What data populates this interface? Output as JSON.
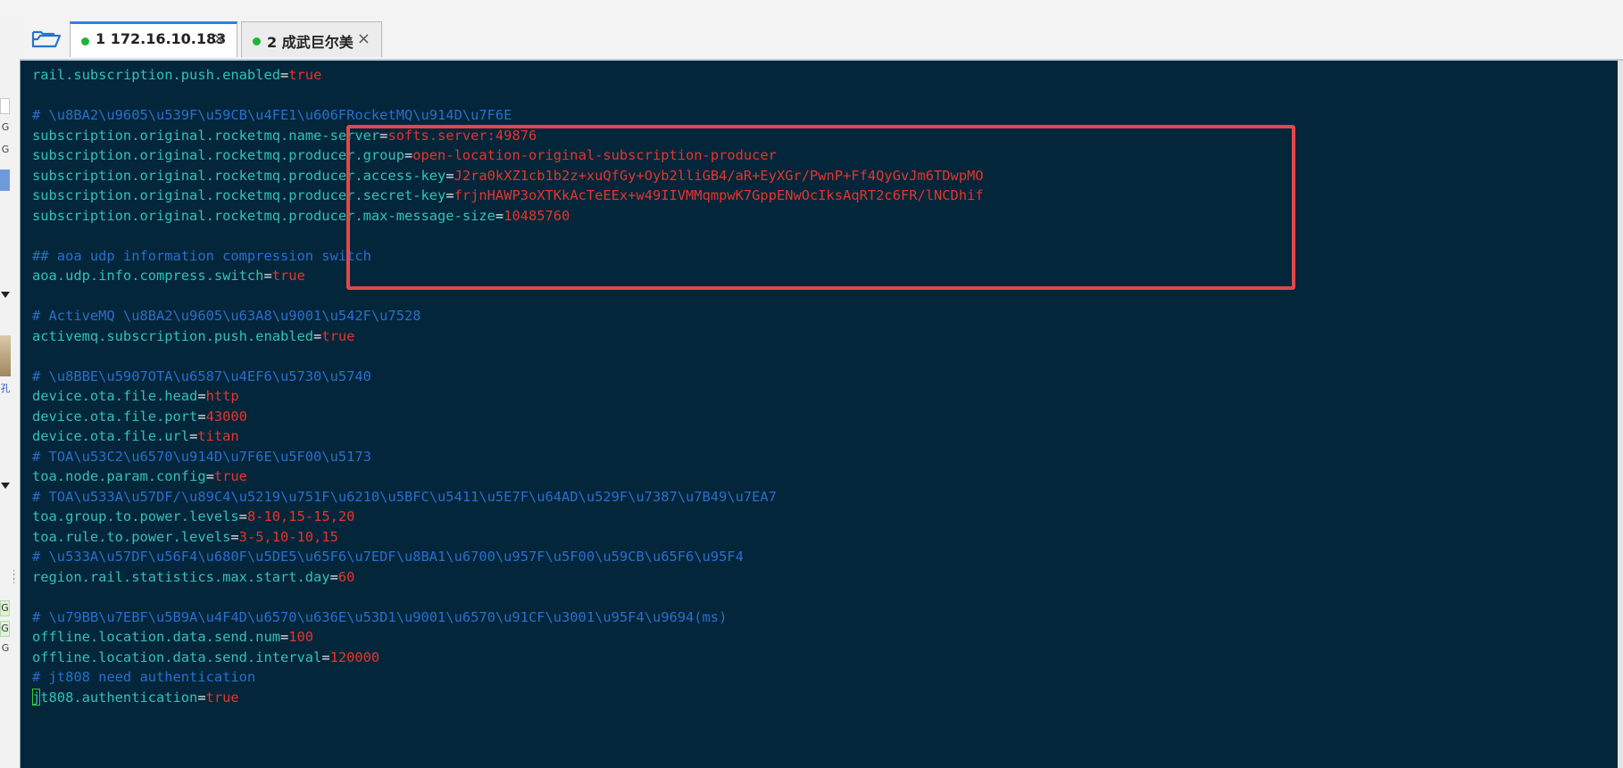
{
  "tabs": [
    {
      "number": "1",
      "title": "172.16.10.183",
      "active": true,
      "status": "connected"
    },
    {
      "number": "2",
      "title": "成武巨尔美",
      "active": false,
      "status": "connected"
    }
  ],
  "close_glyph": "×",
  "left_panel_glyphs": [
    "G",
    "G",
    "G",
    "孔",
    "G",
    "G",
    "G"
  ],
  "terminal_lines": [
    {
      "type": "kv",
      "key": "rail.subscription.push.enabled",
      "value": "true"
    },
    {
      "type": "blank"
    },
    {
      "type": "comment",
      "text": "# \\u8BA2\\u9605\\u539F\\u59CB\\u4FE1\\u606FRocketMQ\\u914D\\u7F6E"
    },
    {
      "type": "kv",
      "key": "subscription.original.rocketmq.name-server",
      "value": "softs.server:49876"
    },
    {
      "type": "kv",
      "key": "subscription.original.rocketmq.producer.group",
      "value": "open-location-original-subscription-producer"
    },
    {
      "type": "kv",
      "key": "subscription.original.rocketmq.producer.access-key",
      "value": "J2ra0kXZ1cb1b2z+xuQfGy+Oyb2lliGB4/aR+EyXGr/PwnP+Ff4QyGvJm6TDwpMO"
    },
    {
      "type": "kv",
      "key": "subscription.original.rocketmq.producer.secret-key",
      "value": "frjnHAWP3oXTKkAcTeEEx+w49IIVMMqmpwK7GppENwOcIksAqRT2c6FR/lNCDhif"
    },
    {
      "type": "kv",
      "key": "subscription.original.rocketmq.producer.max-message-size",
      "value": "10485760"
    },
    {
      "type": "blank"
    },
    {
      "type": "comment",
      "text": "## aoa udp information compression switch"
    },
    {
      "type": "kv",
      "key": "aoa.udp.info.compress.switch",
      "value": "true"
    },
    {
      "type": "blank"
    },
    {
      "type": "comment",
      "text": "# ActiveMQ \\u8BA2\\u9605\\u63A8\\u9001\\u542F\\u7528"
    },
    {
      "type": "kv",
      "key": "activemq.subscription.push.enabled",
      "value": "true"
    },
    {
      "type": "blank"
    },
    {
      "type": "comment",
      "text": "# \\u8BBE\\u5907OTA\\u6587\\u4EF6\\u5730\\u5740"
    },
    {
      "type": "kv",
      "key": "device.ota.file.head",
      "value": "http"
    },
    {
      "type": "kv",
      "key": "device.ota.file.port",
      "value": "43000"
    },
    {
      "type": "kv",
      "key": "device.ota.file.url",
      "value": "titan"
    },
    {
      "type": "comment",
      "text": "# TOA\\u53C2\\u6570\\u914D\\u7F6E\\u5F00\\u5173"
    },
    {
      "type": "kv",
      "key": "toa.node.param.config",
      "value": "true"
    },
    {
      "type": "comment",
      "text": "# TOA\\u533A\\u57DF/\\u89C4\\u5219\\u751F\\u6210\\u5BFC\\u5411\\u5E7F\\u64AD\\u529F\\u7387\\u7B49\\u7EA7"
    },
    {
      "type": "kv",
      "key": "toa.group.to.power.levels",
      "value": "8-10,15-15,20"
    },
    {
      "type": "kv",
      "key": "toa.rule.to.power.levels",
      "value": "3-5,10-10,15"
    },
    {
      "type": "comment",
      "text": "# \\u533A\\u57DF\\u56F4\\u680F\\u5DE5\\u65F6\\u7EDF\\u8BA1\\u6700\\u957F\\u5F00\\u59CB\\u65F6\\u95F4"
    },
    {
      "type": "kv",
      "key": "region.rail.statistics.max.start.day",
      "value": "60"
    },
    {
      "type": "blank"
    },
    {
      "type": "comment",
      "text": "# \\u79BB\\u7EBF\\u5B9A\\u4F4D\\u6570\\u636E\\u53D1\\u9001\\u6570\\u91CF\\u3001\\u95F4\\u9694(ms)"
    },
    {
      "type": "kv",
      "key": "offline.location.data.send.num",
      "value": "100"
    },
    {
      "type": "kv",
      "key": "offline.location.data.send.interval",
      "value": "120000"
    },
    {
      "type": "comment",
      "text": "# jt808 need authentication"
    },
    {
      "type": "kv",
      "key": "jt808.authentication",
      "value": "true",
      "cursor": true
    }
  ],
  "colors": {
    "terminal_bg": "#03263a",
    "key": "#33c2b5",
    "value": "#e8342c",
    "comment": "#2a6fcf",
    "highlight_box": "#e3474b",
    "active_tab_accent": "#2f7fe0",
    "status_dot": "#1fb33a"
  }
}
